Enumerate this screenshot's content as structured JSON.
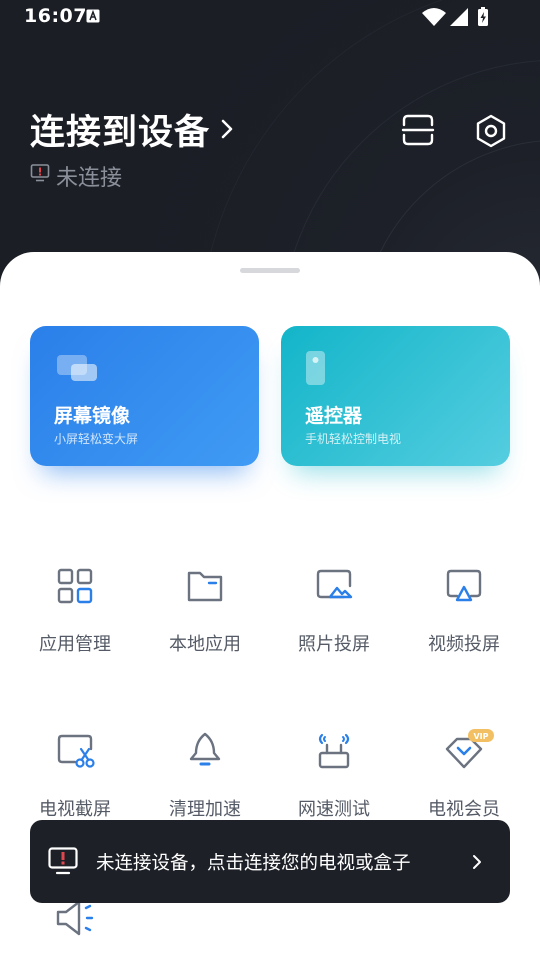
{
  "status_bar": {
    "time": "16:07"
  },
  "header": {
    "title": "连接到设备",
    "status": "未连接"
  },
  "cards": {
    "mirror": {
      "title": "屏幕镜像",
      "subtitle": "小屏轻松变大屏"
    },
    "remote": {
      "title": "遥控器",
      "subtitle": "手机轻松控制电视"
    }
  },
  "tools": [
    {
      "label": "应用管理",
      "icon": "apps-grid-icon"
    },
    {
      "label": "本地应用",
      "icon": "folder-icon"
    },
    {
      "label": "照片投屏",
      "icon": "photo-cast-icon"
    },
    {
      "label": "视频投屏",
      "icon": "video-cast-icon"
    },
    {
      "label": "电视截屏",
      "icon": "tv-screenshot-icon"
    },
    {
      "label": "清理加速",
      "icon": "rocket-icon"
    },
    {
      "label": "网速测试",
      "icon": "router-speed-icon"
    },
    {
      "label": "电视会员",
      "icon": "vip-diamond-icon"
    }
  ],
  "vip_badge": "VIP",
  "toast": {
    "text": "未连接设备，点击连接您的电视或盒子"
  },
  "colors": {
    "accent_blue": "#2b7fe9",
    "accent_cyan": "#13b5c9",
    "icon_gray": "#6b7280",
    "dark_bg": "#1b1e25"
  }
}
